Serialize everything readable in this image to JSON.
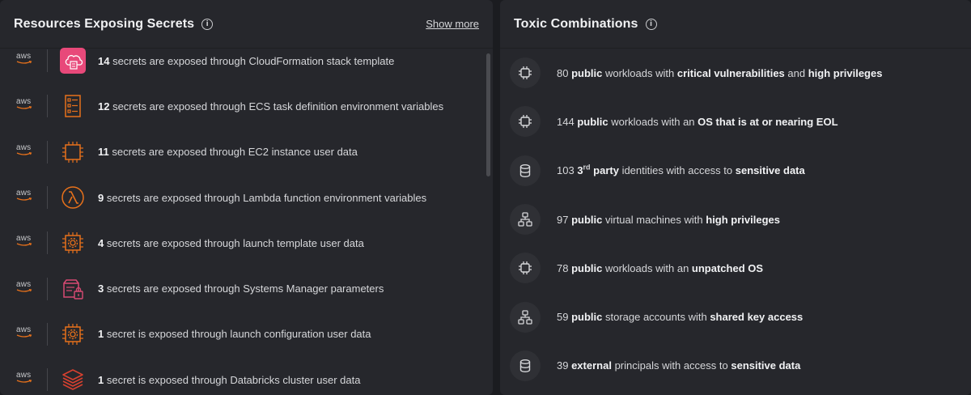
{
  "left_panel": {
    "title": "Resources Exposing Secrets",
    "show_more": "Show more",
    "items": [
      {
        "provider": "aws",
        "icon": "cloudformation-icon",
        "count": "14",
        "text": " secrets are exposed through CloudFormation stack template"
      },
      {
        "provider": "aws",
        "icon": "ecs-task-definition-icon",
        "count": "12",
        "text": " secrets are exposed through ECS task definition environment variables"
      },
      {
        "provider": "aws",
        "icon": "ec2-instance-icon",
        "count": "11",
        "text": " secrets are exposed through EC2 instance user data"
      },
      {
        "provider": "aws",
        "icon": "lambda-icon",
        "count": "9",
        "text": " secrets are exposed through Lambda function environment variables"
      },
      {
        "provider": "aws",
        "icon": "launch-template-icon",
        "count": "4",
        "text": " secrets are exposed through launch template user data"
      },
      {
        "provider": "aws",
        "icon": "systems-manager-icon",
        "count": "3",
        "text": " secrets are exposed through Systems Manager parameters"
      },
      {
        "provider": "aws",
        "icon": "launch-configuration-icon",
        "count": "1",
        "text": " secret is exposed through launch configuration user data"
      },
      {
        "provider": "aws",
        "icon": "databricks-icon",
        "count": "1",
        "text": " secret is exposed through Databricks cluster user data"
      }
    ]
  },
  "right_panel": {
    "title": "Toxic Combinations",
    "items": [
      {
        "icon": "cpu-icon",
        "parts": [
          "80 ",
          "public",
          " workloads with ",
          "critical vulnerabilities",
          " and ",
          "high privileges",
          ""
        ]
      },
      {
        "icon": "cpu-icon",
        "parts": [
          "144 ",
          "public",
          " workloads with an ",
          "OS that is at or nearing EOL",
          "",
          "",
          ""
        ]
      },
      {
        "icon": "database-icon",
        "parts": [
          "103 ",
          "3",
          "rd",
          " party",
          " identities with access to ",
          "sensitive data",
          ""
        ]
      },
      {
        "icon": "network-icon",
        "parts": [
          "97 ",
          "public",
          " virtual machines with ",
          "high privileges",
          "",
          "",
          ""
        ]
      },
      {
        "icon": "cpu-icon",
        "parts": [
          "78 ",
          "public",
          " workloads with an ",
          "unpatched OS",
          "",
          "",
          ""
        ]
      },
      {
        "icon": "network-icon",
        "parts": [
          "59 ",
          "public",
          " storage accounts with ",
          "shared key access",
          "",
          "",
          ""
        ]
      },
      {
        "icon": "database-icon",
        "parts": [
          "39 ",
          "external",
          " principals with access to ",
          "sensitive data",
          "",
          "",
          ""
        ]
      }
    ]
  },
  "colors": {
    "background": "#1b1c20",
    "panel": "#26272c",
    "aws_orange": "#e7711b",
    "cloudformation_pink": "#e8497a",
    "systems_manager_pink": "#d94a73",
    "databricks_red": "#d6402f"
  }
}
